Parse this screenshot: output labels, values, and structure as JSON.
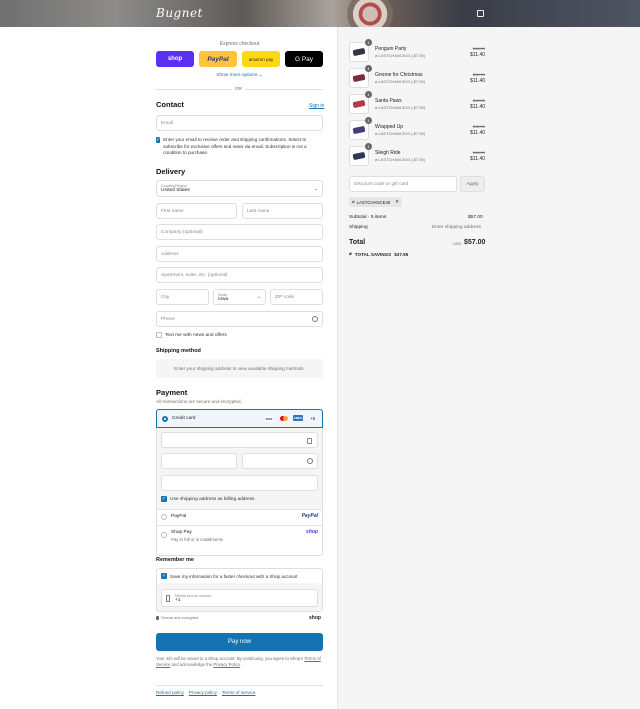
{
  "brand": {
    "logo": "Bugnet"
  },
  "express": {
    "title": "Express checkout",
    "buttons": [
      "shop",
      "PayPal",
      "amazon pay",
      "G Pay"
    ],
    "show_more": "Show more options ⌄",
    "or": "OR"
  },
  "contact": {
    "heading": "Contact",
    "sign_in": "Sign in",
    "email_placeholder": "Email",
    "optin": "Enter your email to receive order and shipping confirmations. Select to subscribe for exclusive offers and news via email. Subscription is not a condition to purchase."
  },
  "delivery": {
    "heading": "Delivery",
    "country_label": "Country/Region",
    "country_value": "United States",
    "first_name": "First name",
    "last_name": "Last name",
    "company": "Company (optional)",
    "address": "Address",
    "apartment": "Apartment, suite, etc. (optional)",
    "city": "City",
    "state_label": "State",
    "state_value": "Iowa",
    "zip": "ZIP code",
    "phone": "Phone",
    "text_me": "Text me with news and offers"
  },
  "shipping_method": {
    "heading": "Shipping method",
    "note": "Enter your shipping address to view available shipping methods."
  },
  "payment": {
    "heading": "Payment",
    "subtitle": "All transactions are secure and encrypted.",
    "credit_card": "Credit card",
    "card_brands": [
      "VISA",
      "MC",
      "AMEX"
    ],
    "more_cards": "+5",
    "billing_same": "Use shipping address as billing address",
    "paypal_label": "PayPal",
    "paypal_logo": "PayPal",
    "shoppay_label": "Shop Pay",
    "shoppay_sub": "Pay in full or in installments",
    "shoppay_logo": "shop"
  },
  "remember": {
    "heading": "Remember me",
    "save_label": "Save my information for a faster checkout with a Shop account",
    "mobile_label": "Mobile phone number",
    "mobile_value": "+1",
    "secure": "Secure and encrypted",
    "shop_logo": "shop"
  },
  "pay_now": "Pay now",
  "legal": {
    "line1": "Your info will be saved to a Shop account. By continuing, you agree to Shop's",
    "terms": "Terms of Service",
    "mid": "and acknowledge the",
    "privacy": "Privacy Policy",
    "end": "."
  },
  "footer_links": [
    "Refund policy",
    "Privacy policy",
    "Terms of service"
  ],
  "cart": {
    "items": [
      {
        "name": "Penguin Party",
        "discount": "LASTCHANCE40 (-$7.59)",
        "old": "$18.99",
        "price": "$11.40",
        "qty": "1"
      },
      {
        "name": "Gnome for Christmas",
        "discount": "LASTCHANCE40 (-$7.59)",
        "old": "$18.99",
        "price": "$11.40",
        "qty": "1"
      },
      {
        "name": "Santa Paws",
        "discount": "LASTCHANCE40 (-$7.59)",
        "old": "$18.99",
        "price": "$11.40",
        "qty": "1"
      },
      {
        "name": "Wrapped Up",
        "discount": "LASTCHANCE40 (-$7.59)",
        "old": "$18.99",
        "price": "$11.40",
        "qty": "1"
      },
      {
        "name": "Sleigh Ride",
        "discount": "LASTCHANCE40 (-$7.59)",
        "old": "$18.99",
        "price": "$11.40",
        "qty": "1"
      }
    ],
    "discount_placeholder": "Discount code or gift card",
    "apply": "Apply",
    "applied_code": "LASTCHANCE40",
    "subtotal_label": "Subtotal · 5 items",
    "subtotal_value": "$57.00",
    "shipping_label": "Shipping",
    "shipping_value": "Enter shipping address",
    "total_label": "Total",
    "currency": "USD",
    "total_value": "$57.00",
    "savings_label": "TOTAL SAVINGS",
    "savings_value": "$37.95"
  }
}
